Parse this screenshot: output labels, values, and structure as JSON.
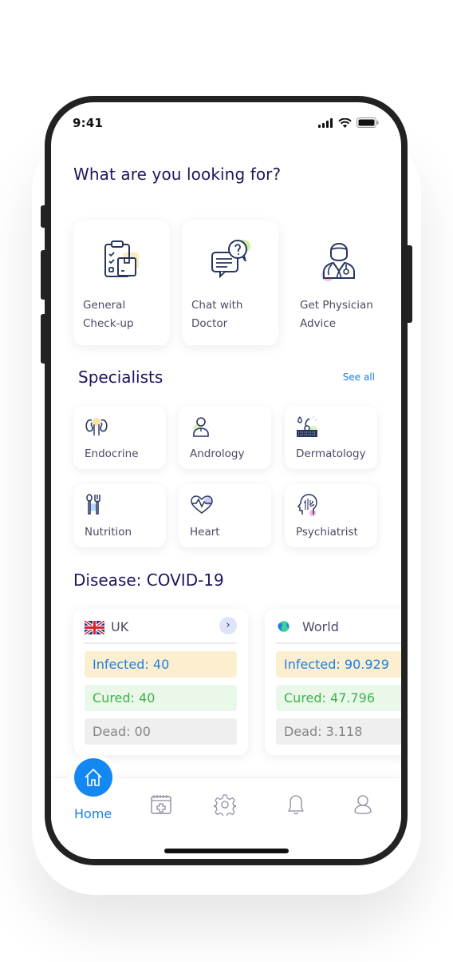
{
  "status_bar": {
    "time": "9:41"
  },
  "page": {
    "title": "What are you looking for?"
  },
  "services": [
    {
      "icon": "clipboard-icon",
      "line1": "General",
      "line2": "Check-up"
    },
    {
      "icon": "chat-question-icon",
      "line1": "Chat with",
      "line2": "Doctor"
    },
    {
      "icon": "doctor-icon",
      "line1": "Get Physician",
      "line2": "Advice"
    }
  ],
  "specialists": {
    "heading": "Specialists",
    "see_all": "See all",
    "items": [
      {
        "icon": "kidney-icon",
        "label": "Endocrine"
      },
      {
        "icon": "male-person-icon",
        "label": "Andrology"
      },
      {
        "icon": "skin-layer-icon",
        "label": "Dermatology"
      },
      {
        "icon": "fork-spoon-icon",
        "label": "Nutrition"
      },
      {
        "icon": "heart-pulse-icon",
        "label": "Heart"
      },
      {
        "icon": "brain-head-icon",
        "label": "Psychiatrist"
      }
    ]
  },
  "disease": {
    "heading": "Disease: COVID-19",
    "regions": [
      {
        "icon": "uk-flag-icon",
        "name": "UK",
        "infected": "Infected: 40",
        "cured": "Cured: 40",
        "dead": "Dead: 00"
      },
      {
        "icon": "globe-icon",
        "name": "World",
        "infected": "Infected: 90.929",
        "cured": "Cured: 47.796",
        "dead": "Dead: 3.118"
      }
    ]
  },
  "bottom_nav": {
    "items": [
      {
        "icon": "home-icon",
        "label": "Home",
        "active": true
      },
      {
        "icon": "calendar-medical-icon"
      },
      {
        "icon": "gear-icon"
      },
      {
        "icon": "bell-icon"
      },
      {
        "icon": "user-icon"
      }
    ]
  },
  "colors": {
    "navy": "#1c1760",
    "accent_blue": "#1387f2",
    "infected_bg": "#fcefcf",
    "cured_bg": "#eaf8ea",
    "dead_bg": "#efefef"
  }
}
